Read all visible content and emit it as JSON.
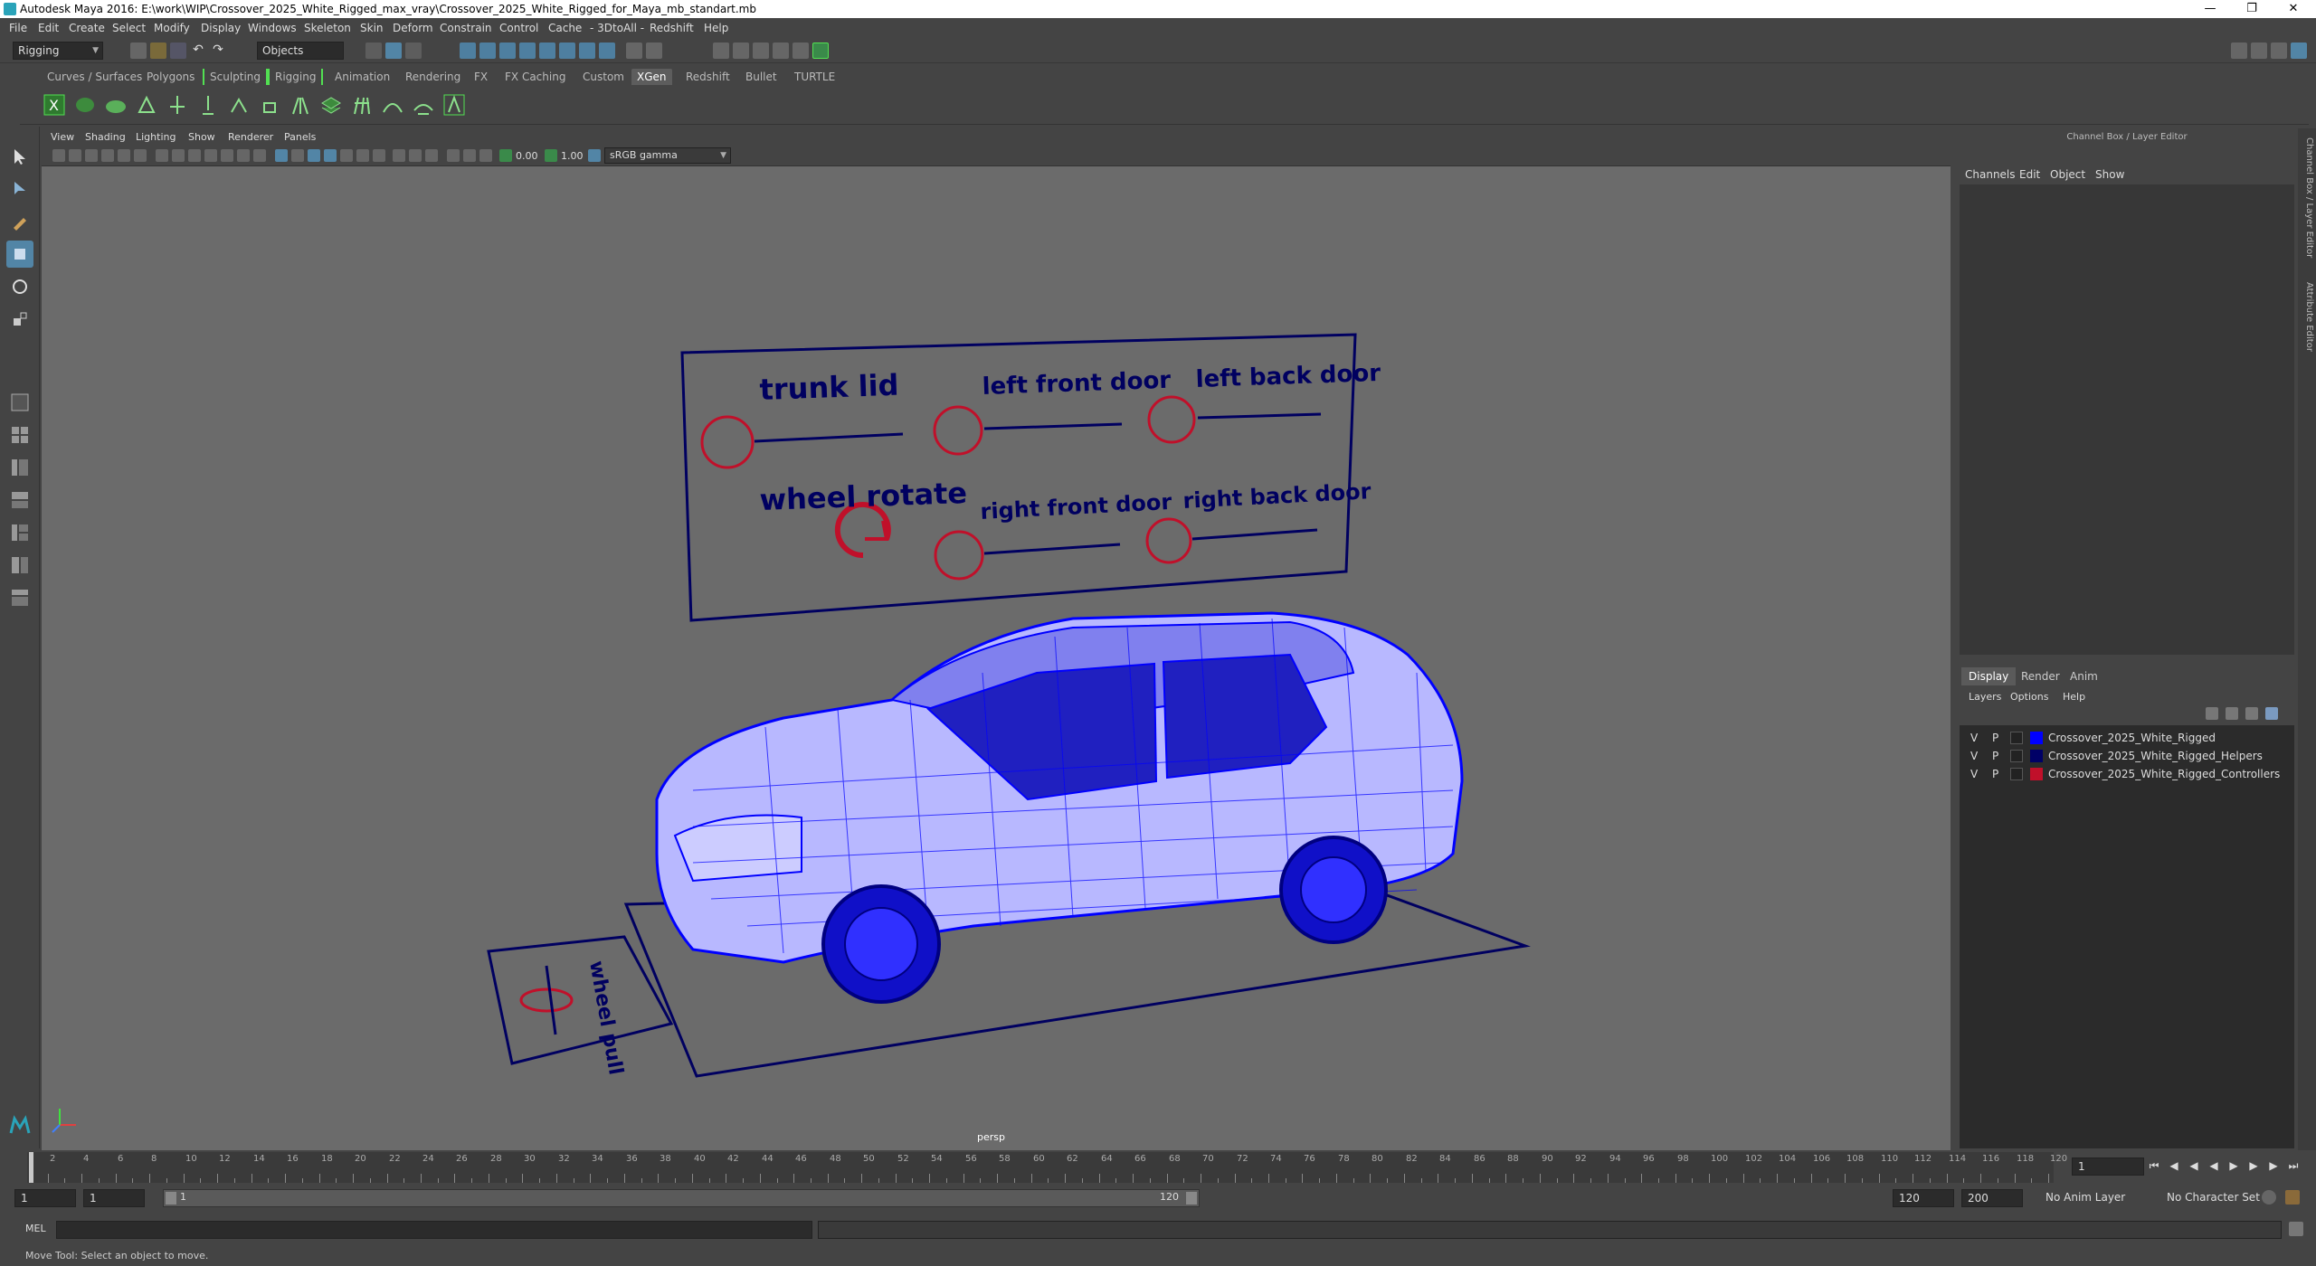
{
  "window": {
    "title": "Autodesk Maya 2016: E:\\work\\WIP\\Crossover_2025_White_Rigged_max_vray\\Crossover_2025_White_Rigged_for_Maya_mb_standart.mb"
  },
  "menus": [
    "File",
    "Edit",
    "Create",
    "Select",
    "Modify",
    "Display",
    "Windows",
    "Skeleton",
    "Skin",
    "Deform",
    "Constrain",
    "Control",
    "Cache",
    "- 3DtoAll -",
    "Redshift",
    "Help"
  ],
  "status": {
    "mode": "Rigging",
    "selection_mode": "Objects"
  },
  "shelf_tabs": [
    "Curves / Surfaces",
    "Polygons",
    "Sculpting",
    "Rigging",
    "Animation",
    "Rendering",
    "FX",
    "FX Caching",
    "Custom",
    "XGen",
    "Redshift",
    "Bullet",
    "TURTLE"
  ],
  "shelf_active_tab": "XGen",
  "panel_menus": [
    "View",
    "Shading",
    "Lighting",
    "Show",
    "Renderer",
    "Panels"
  ],
  "panel_toolbar": {
    "exposure": "0.00",
    "gamma": "1.00",
    "color_space": "sRGB gamma"
  },
  "viewport": {
    "camera": "persp",
    "controls_board": {
      "labels": [
        "trunk lid",
        "left front door",
        "left back door",
        "wheel rotate",
        "right front door",
        "right back door"
      ]
    },
    "side_control_label": "wheel pull"
  },
  "right_panel": {
    "title": "Channel Box / Layer Editor",
    "menus": [
      "Channels",
      "Edit",
      "Object",
      "Show"
    ],
    "layer_tabs": [
      "Display",
      "Render",
      "Anim"
    ],
    "layer_menus": [
      "Layers",
      "Options",
      "Help"
    ],
    "layers": [
      {
        "v": "V",
        "p": "P",
        "name": "Crossover_2025_White_Rigged",
        "color": "#0000ff"
      },
      {
        "v": "V",
        "p": "P",
        "name": "Crossover_2025_White_Rigged_Helpers",
        "color": "#000066"
      },
      {
        "v": "V",
        "p": "P",
        "name": "Crossover_2025_White_Rigged_Controllers",
        "color": "#c0102a"
      }
    ]
  },
  "side_tabs": [
    "Channel Box / Layer Editor",
    "Attribute Editor"
  ],
  "timeline": {
    "ticks": [
      "2",
      "4",
      "6",
      "8",
      "10",
      "12",
      "14",
      "16",
      "18",
      "20",
      "22",
      "24",
      "26",
      "28",
      "30",
      "32",
      "34",
      "36",
      "38",
      "40",
      "42",
      "44",
      "46",
      "48",
      "50",
      "52",
      "54",
      "56",
      "58",
      "60",
      "62",
      "64",
      "66",
      "68",
      "70",
      "72",
      "74",
      "76",
      "78",
      "80",
      "82",
      "84",
      "86",
      "88",
      "90",
      "92",
      "94",
      "96",
      "98",
      "100",
      "102",
      "104",
      "106",
      "108",
      "110",
      "112",
      "114",
      "116",
      "118",
      "120"
    ],
    "current_frame": "1"
  },
  "range": {
    "start": "1",
    "inner_start": "1",
    "slider_start": "1",
    "slider_end": "120",
    "inner_end": "120",
    "end": "200",
    "anim_layer": "No Anim Layer",
    "char_set": "No Character Set"
  },
  "command": {
    "lang": "MEL"
  },
  "help_line": "Move Tool: Select an object to move."
}
